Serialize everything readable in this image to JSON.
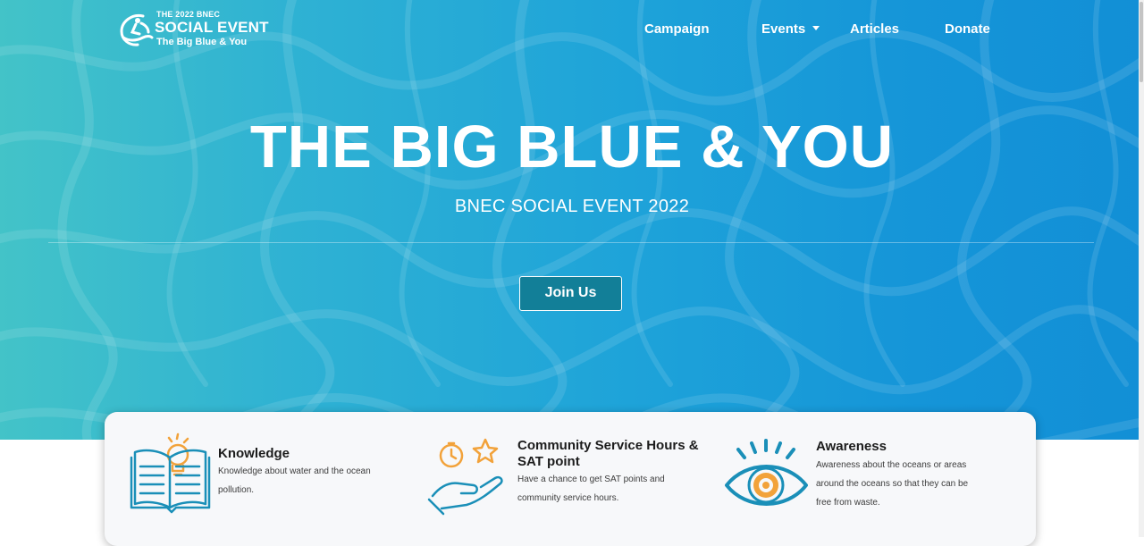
{
  "brand": {
    "small": "THE 2022 BNEC",
    "big": "SOCIAL EVENT",
    "sub": "The Big Blue & You"
  },
  "nav": {
    "campaign": "Campaign",
    "events": "Events",
    "articles": "Articles",
    "donate": "Donate"
  },
  "hero": {
    "title": "THE BIG BLUE & YOU",
    "subtitle": "BNEC SOCIAL EVENT 2022",
    "cta": "Join Us"
  },
  "features": [
    {
      "icon": "open-book-lightbulb-icon",
      "title": "Knowledge",
      "text_line1": "Knowledge about water and the ocean",
      "text_line2": "pollution."
    },
    {
      "icon": "hand-clock-star-icon",
      "title_line1": "Community Service Hours &",
      "title_line2": "SAT point",
      "text_line1": "Have a chance to get SAT points and",
      "text_line2": "community service hours."
    },
    {
      "icon": "eye-icon",
      "title": "Awareness",
      "text_line1": "Awareness about the oceans or areas",
      "text_line2": "around the oceans so that they can be",
      "text_line3": "free from waste."
    }
  ],
  "colors": {
    "hero_start": "#43c3c8",
    "hero_end": "#128fd6",
    "button": "#127f98",
    "icon_blue": "#1a8fb8",
    "icon_orange": "#f2a23a"
  }
}
